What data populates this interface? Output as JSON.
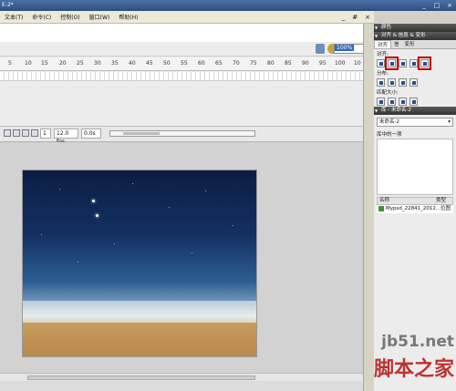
{
  "window": {
    "title": "E-2*",
    "buttons": [
      "_",
      "□",
      "×"
    ]
  },
  "menu": {
    "items": [
      "文本(T)",
      "命令(C)",
      "控制(O)",
      "窗口(W)",
      "帮助(H)"
    ],
    "doc_controls": [
      "_",
      "#",
      "×"
    ]
  },
  "doc_toolbar": {
    "zoom": "100%"
  },
  "timeline": {
    "ruler": [
      "5",
      "10",
      "15",
      "20",
      "25",
      "30",
      "35",
      "40",
      "45",
      "50",
      "55",
      "60",
      "65",
      "70",
      "75",
      "80",
      "85",
      "90",
      "95",
      "100",
      "10"
    ],
    "frame": "1",
    "fps": "12.0 fps",
    "time": "0.0s"
  },
  "panels": {
    "color": {
      "title": "颜色"
    },
    "align": {
      "title": "对齐 & 信息 & 变形",
      "tabs": [
        "对齐",
        "信",
        "变形"
      ],
      "align_label": "对齐:",
      "distribute_label": "分布:",
      "match_label": "匹配大小:",
      "space_label": "间隔:",
      "relative_label": "相对于",
      "stage_label": "舞台:"
    },
    "library": {
      "title": "库 - 未命名-2",
      "select": "未命名-2",
      "count": "库中的一项",
      "col_name": "名称",
      "col_type": "类型",
      "items": [
        {
          "name": "Mypsd_22841_2012...",
          "type": "位图"
        }
      ]
    }
  },
  "watermark": {
    "site": "jb51.net",
    "text": "脚本之家"
  }
}
